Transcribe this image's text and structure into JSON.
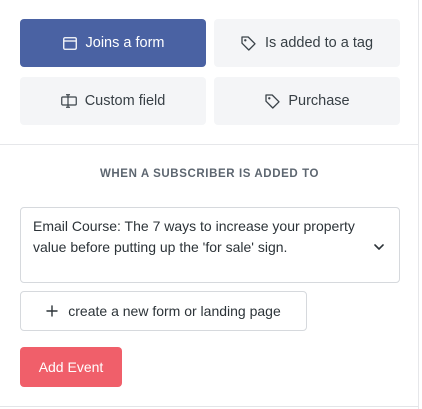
{
  "triggers": [
    {
      "label": "Joins a form",
      "icon": "form-icon",
      "selected": true
    },
    {
      "label": "Is added to a tag",
      "icon": "tag-icon",
      "selected": false
    },
    {
      "label": "Custom field",
      "icon": "custom-field-icon",
      "selected": false
    },
    {
      "label": "Purchase",
      "icon": "purchase-tag-icon",
      "selected": false
    }
  ],
  "section": {
    "heading": "WHEN A SUBSCRIBER IS ADDED TO"
  },
  "form_select": {
    "selected_value": "Email Course: The 7 ways to increase your property value before putting up the 'for sale' sign."
  },
  "create_form_button": {
    "label": "create a new form or landing page"
  },
  "add_event_button": {
    "label": "Add Event"
  },
  "colors": {
    "selected_trigger": "#4a62a3",
    "trigger_background": "#f4f5f7",
    "primary_action": "#f05f6a"
  }
}
